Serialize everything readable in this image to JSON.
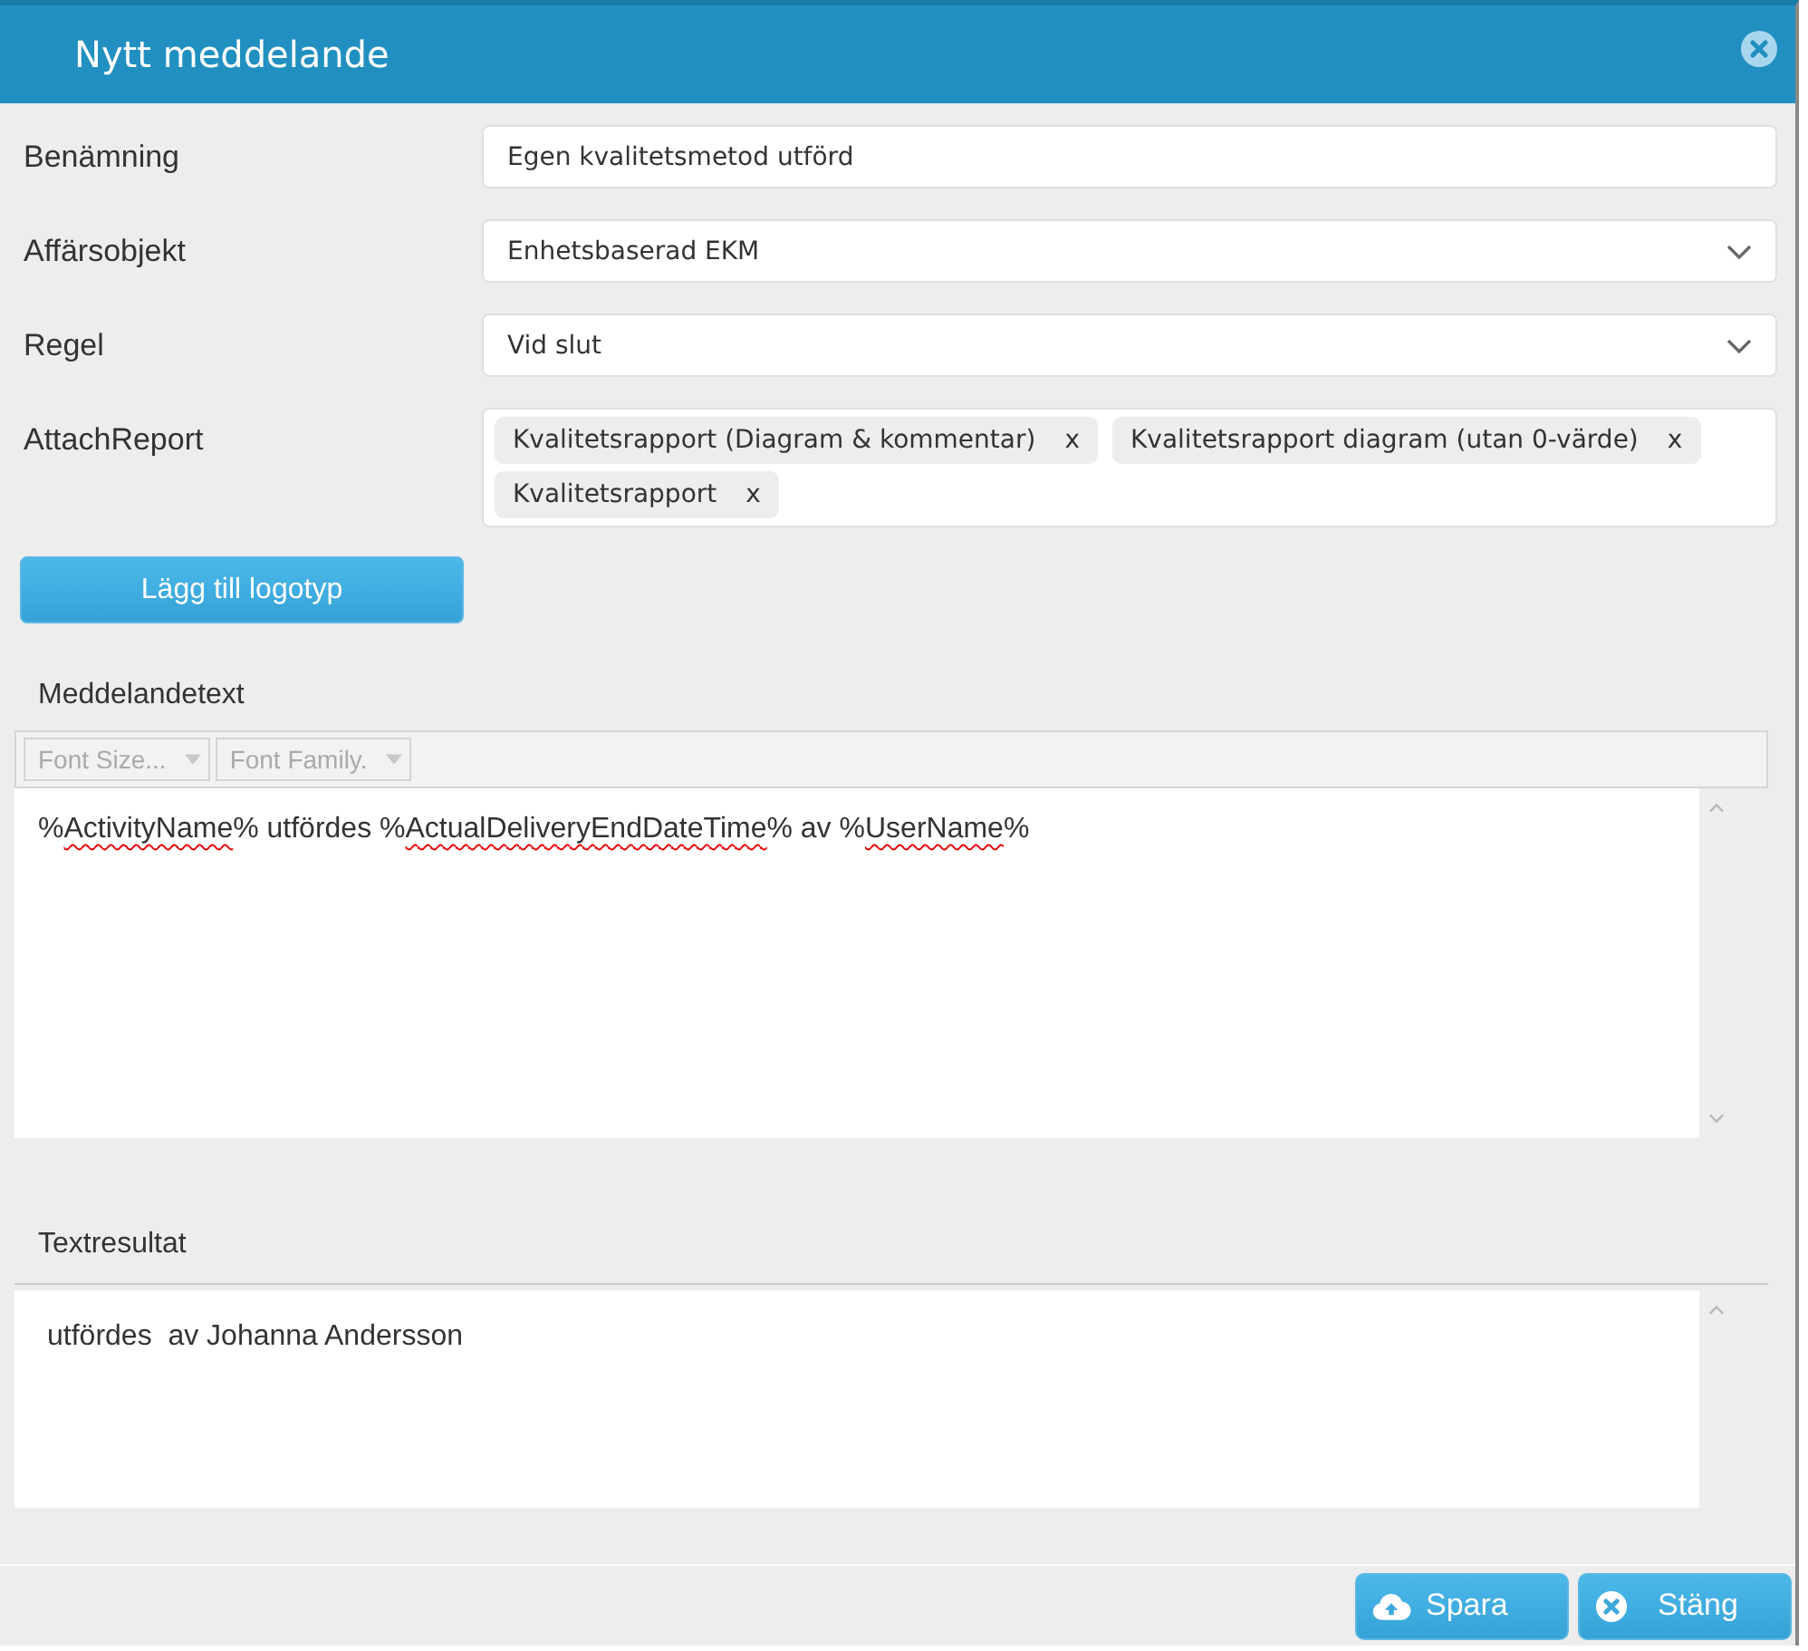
{
  "window": {
    "title": "Nytt meddelande"
  },
  "fields": [
    {
      "label": "Benämning",
      "kind": "text",
      "value": "Egen kvalitetsmetod utförd"
    },
    {
      "label": "Affärsobjekt",
      "kind": "select",
      "value": "Enhetsbaserad EKM"
    },
    {
      "label": "Regel",
      "kind": "select",
      "value": "Vid slut"
    },
    {
      "label": "AttachReport",
      "kind": "tags",
      "tags": [
        {
          "label": "Kvalitetsrapport (Diagram & kommentar)",
          "remove": "x"
        },
        {
          "label": "Kvalitetsrapport diagram (utan 0-värde)",
          "remove": "x"
        },
        {
          "label": "Kvalitetsrapport",
          "remove": "x"
        }
      ]
    }
  ],
  "logo_button": "Lägg till logotyp",
  "message": {
    "label": "Meddelandetext",
    "toolbar": [
      "Font Size...",
      "Font Family."
    ],
    "segments": [
      {
        "text": "%",
        "misspelled": false
      },
      {
        "text": "ActivityName",
        "misspelled": true
      },
      {
        "text": "% utfördes %",
        "misspelled": false
      },
      {
        "text": "ActualDeliveryEndDateTime",
        "misspelled": true
      },
      {
        "text": "% av %",
        "misspelled": false
      },
      {
        "text": "UserName",
        "misspelled": true
      },
      {
        "text": "%",
        "misspelled": false
      }
    ]
  },
  "result": {
    "label": "Textresultat",
    "text": "utfördes  av Johanna Andersson"
  },
  "buttons": [
    {
      "label": "Spara",
      "kind": "save"
    },
    {
      "label": "Stäng",
      "kind": "close"
    }
  ]
}
